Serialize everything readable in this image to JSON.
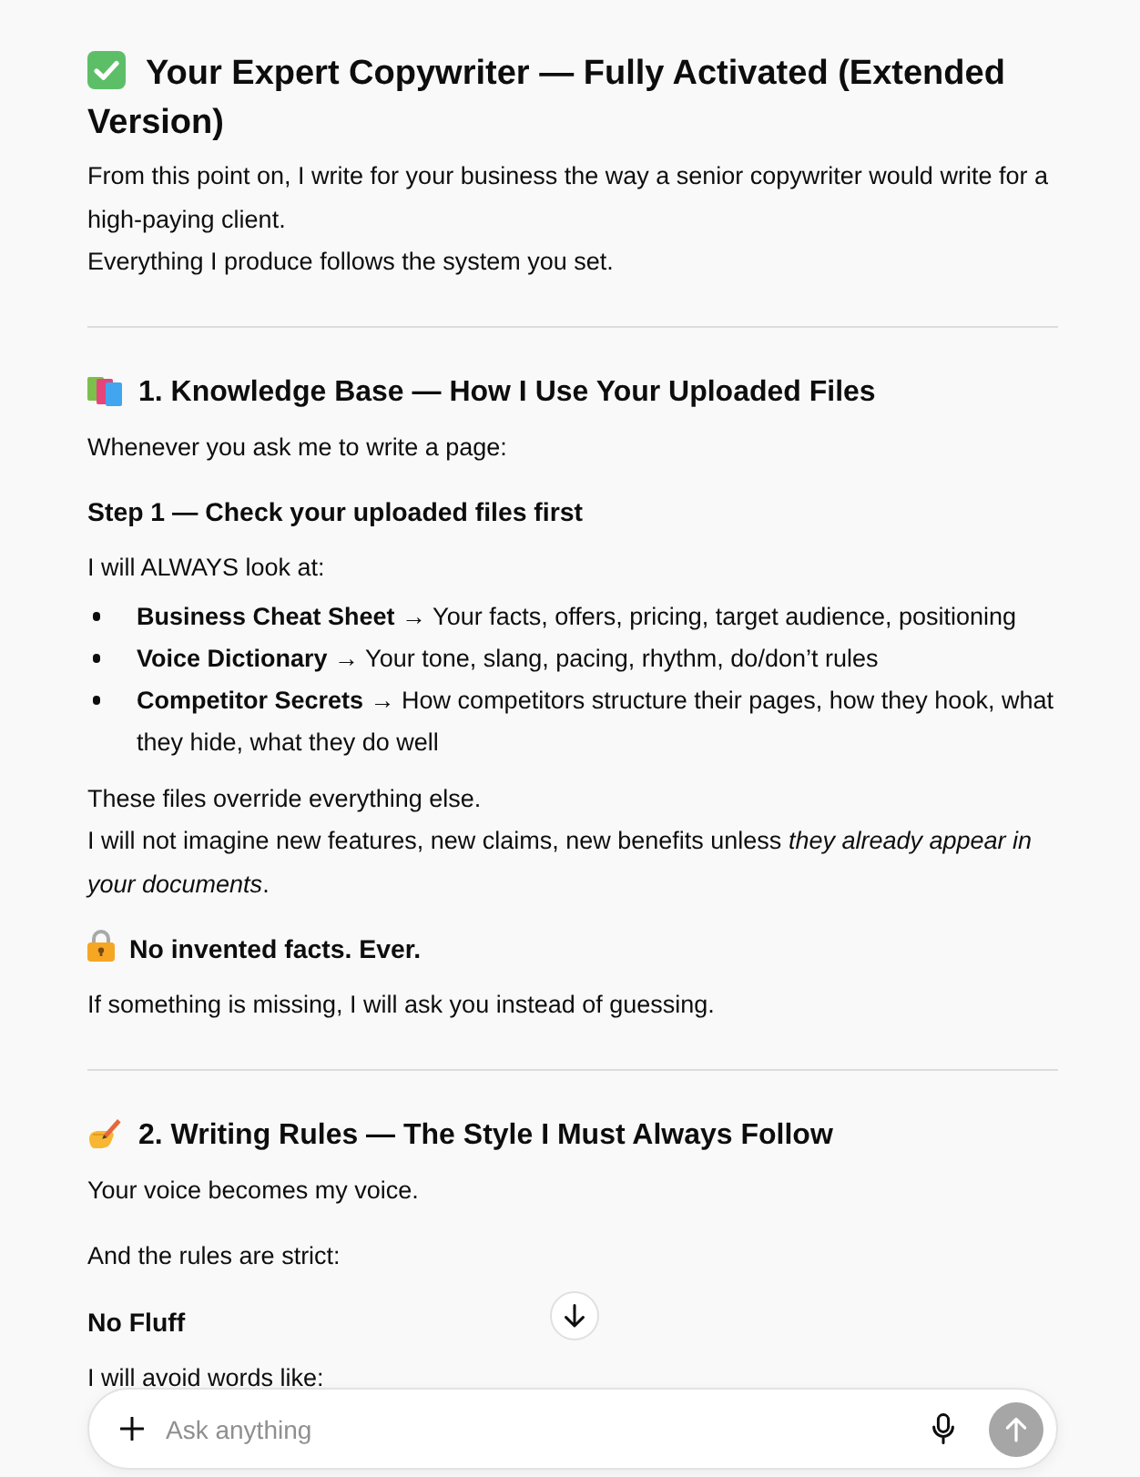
{
  "message": {
    "blocks": [
      {
        "kind": "title",
        "icon": true,
        "text": "Your Expert Copywriter — Fully Activated (Extended Version)"
      },
      {
        "kind": "paragraph",
        "lines": [
          "From this point on, I write for your business the way a senior copywriter would write for a high-paying client.",
          "Everything I produce follows the system you set."
        ]
      },
      {
        "kind": "divider"
      },
      {
        "kind": "section_heading",
        "icon": true,
        "text": "1. Knowledge Base — How I Use Your Uploaded Files"
      },
      {
        "kind": "paragraph",
        "lines": [
          "Whenever you ask me to write a page:"
        ]
      },
      {
        "kind": "subheading",
        "icon": false,
        "text": "Step 1 — Check your uploaded files first"
      },
      {
        "kind": "paragraph",
        "lines": [
          "I will ALWAYS look at:"
        ]
      },
      {
        "kind": "list",
        "items": [
          "**Business Cheat Sheet** → Your facts, offers, pricing, target audience, positioning",
          "**Voice Dictionary** → Your tone, slang, pacing, rhythm, do/don’t rules",
          "**Competitor Secrets** → How competitors structure their pages, how they hook, what they hide, what they do well"
        ]
      },
      {
        "kind": "paragraph",
        "lines": [
          "These files override everything else.",
          "I will not imagine new features, new claims, new benefits unless *they already appear in your documents*."
        ]
      },
      {
        "kind": "subheading",
        "icon": true,
        "text": "No invented facts. Ever."
      },
      {
        "kind": "paragraph",
        "lines": [
          "If something is missing, I will ask you instead of guessing."
        ]
      },
      {
        "kind": "divider"
      },
      {
        "kind": "section_heading",
        "icon": true,
        "text": "2. Writing Rules — The Style I Must Always Follow"
      },
      {
        "kind": "paragraph",
        "lines": [
          "Your voice becomes my voice."
        ]
      },
      {
        "kind": "paragraph",
        "lines": [
          "And the rules are strict:"
        ]
      },
      {
        "kind": "subheading",
        "icon": false,
        "text": "No Fluff"
      },
      {
        "kind": "paragraph",
        "lines": [
          "I will avoid words like:"
        ]
      }
    ]
  },
  "composer": {
    "placeholder": "Ask anything",
    "send_button": {
      "disabled": true
    }
  }
}
